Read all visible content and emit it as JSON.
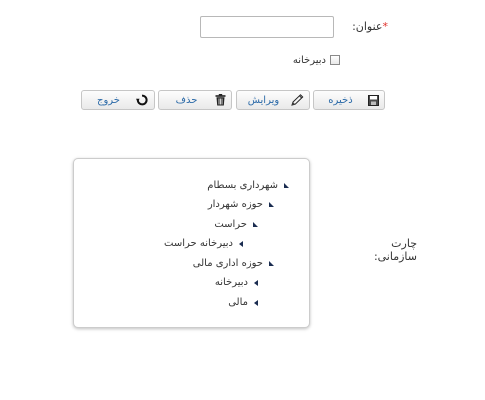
{
  "form": {
    "title_label": "عنوان:",
    "title_required_mark": "*",
    "title_value": "",
    "secretariat_checkbox_label": "دبیرخانه",
    "secretariat_checked": false,
    "org_chart_label": "چارت سازمانی:"
  },
  "toolbar": {
    "save_label": "ذخیره",
    "edit_label": "ویرایش",
    "delete_label": "حذف",
    "exit_label": "خروج"
  },
  "tree": [
    {
      "label": "شهرداری بسطام",
      "expanded": true
    },
    {
      "label": "حوزه شهردار",
      "expanded": true
    },
    {
      "label": "حراست",
      "expanded": true
    },
    {
      "label": "دبیرخانه حراست",
      "expanded": false
    },
    {
      "label": "حوزه اداری مالی",
      "expanded": true
    },
    {
      "label": "دبیرخانه",
      "expanded": false
    },
    {
      "label": "مالی",
      "expanded": false
    }
  ],
  "colors": {
    "required_mark": "#e0302a",
    "button_text": "#2b6aa8",
    "tree_arrow": "#1a2c50"
  }
}
